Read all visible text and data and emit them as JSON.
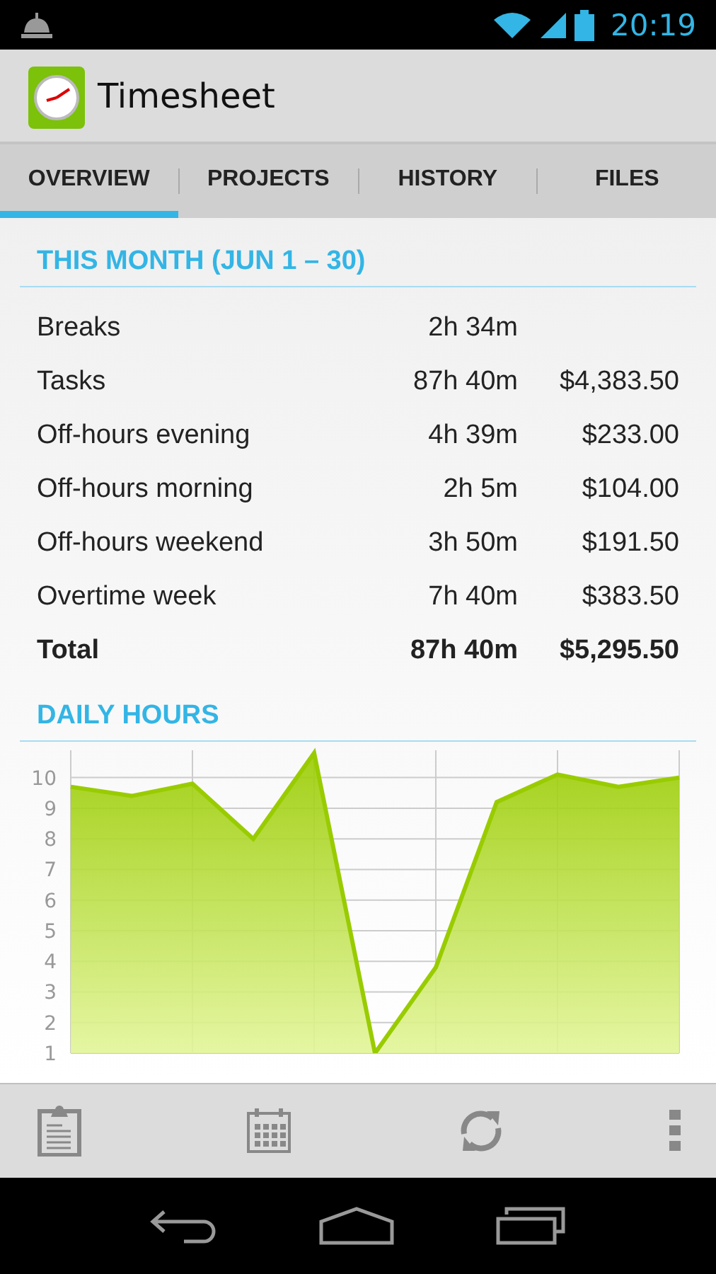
{
  "status_bar": {
    "time": "20:19"
  },
  "app": {
    "title": "Timesheet"
  },
  "tabs": [
    {
      "label": "OVERVIEW",
      "selected": true
    },
    {
      "label": "PROJECTS",
      "selected": false
    },
    {
      "label": "HISTORY",
      "selected": false
    },
    {
      "label": "FILES",
      "selected": false
    }
  ],
  "summary": {
    "title": "THIS MONTH (JUN 1 – 30)",
    "rows": [
      {
        "kind": "item",
        "label": "Breaks",
        "hours": "2h 34m"
      },
      {
        "kind": "item",
        "label": "Tasks",
        "hours": "87h 40m",
        "amount": "$4,383.50"
      },
      {
        "kind": "item",
        "label": "Off-hours evening",
        "hours": "4h 39m",
        "amount": "$233.00"
      },
      {
        "kind": "item",
        "label": "Off-hours morning",
        "hours": "2h 5m",
        "amount": "$104.00"
      },
      {
        "kind": "item",
        "label": "Off-hours weekend",
        "hours": "3h 50m",
        "amount": "$191.50"
      },
      {
        "kind": "item",
        "label": "Overtime week",
        "hours": "7h 40m",
        "amount": "$383.50"
      },
      {
        "kind": "total",
        "label": "Total",
        "hours": "87h 40m",
        "amount": "$5,295.50"
      }
    ]
  },
  "daily_hours": {
    "title": "DAILY HOURS",
    "chart_data": {
      "type": "area",
      "categories": [
        null,
        null,
        null,
        null,
        null,
        null,
        null,
        null,
        null,
        null,
        null
      ],
      "ylim": [
        1,
        10.8
      ],
      "grid": true,
      "yticks": [
        1,
        2,
        3,
        4,
        5,
        6,
        7,
        8,
        9,
        10
      ],
      "series": [
        {
          "color": "#99cc00",
          "values": [
            9.7,
            9.4,
            9.8,
            8.0,
            10.8,
            1,
            3.8,
            9.2,
            10.1,
            9.7,
            10.0
          ]
        }
      ]
    }
  }
}
